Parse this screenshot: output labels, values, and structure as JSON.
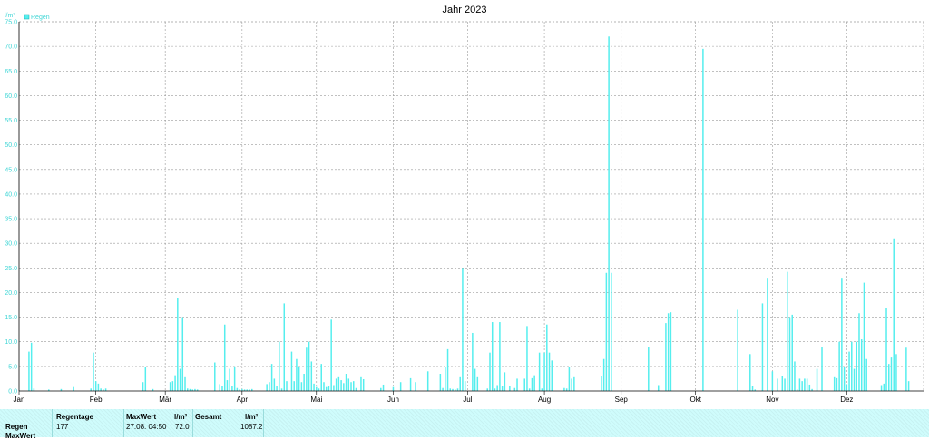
{
  "chart_data": {
    "type": "bar",
    "title": "Jahr 2023",
    "ylabel": "l/m²",
    "ylim": [
      0,
      75
    ],
    "yticks": [
      "0.0",
      "5.0",
      "10.0",
      "15.0",
      "20.0",
      "25.0",
      "30.0",
      "35.0",
      "40.0",
      "45.0",
      "50.0",
      "55.0",
      "60.0",
      "65.0",
      "70.0",
      "75.0"
    ],
    "months": [
      "Jan",
      "Feb",
      "Mär",
      "Apr",
      "Mai",
      "Jun",
      "Jul",
      "Aug",
      "Sep",
      "Okt",
      "Nov",
      "Dez"
    ],
    "grid": true,
    "legend_position": "top-left",
    "series": [
      {
        "name": "Regen",
        "color": "#55eeee",
        "days": [
          4,
          5,
          6,
          12,
          17,
          22,
          29,
          30,
          31,
          32,
          33,
          34,
          35,
          50,
          51,
          54,
          61,
          62,
          63,
          64,
          65,
          66,
          67,
          68,
          69,
          70,
          71,
          72,
          79,
          81,
          82,
          83,
          84,
          85,
          86,
          87,
          88,
          89,
          90,
          91,
          92,
          93,
          94,
          100,
          101,
          102,
          103,
          104,
          105,
          106,
          107,
          108,
          110,
          111,
          112,
          113,
          114,
          115,
          116,
          117,
          118,
          119,
          120,
          121,
          122,
          123,
          124,
          125,
          126,
          127,
          128,
          129,
          130,
          131,
          132,
          133,
          134,
          135,
          136,
          138,
          139,
          146,
          147,
          151,
          154,
          158,
          160,
          165,
          170,
          171,
          172,
          173,
          174,
          175,
          176,
          177,
          178,
          179,
          180,
          183,
          184,
          185,
          189,
          190,
          191,
          192,
          193,
          194,
          195,
          196,
          198,
          200,
          201,
          204,
          205,
          206,
          207,
          208,
          210,
          211,
          212,
          213,
          214,
          215,
          220,
          221,
          222,
          223,
          224,
          235,
          236,
          237,
          238,
          239,
          254,
          258,
          261,
          262,
          263,
          276,
          290,
          295,
          296,
          297,
          300,
          302,
          304,
          306,
          308,
          309,
          310,
          311,
          312,
          313,
          314,
          315,
          316,
          317,
          318,
          319,
          320,
          322,
          324,
          329,
          330,
          331,
          332,
          333,
          334,
          335,
          336,
          337,
          338,
          339,
          340,
          341,
          342,
          348,
          349,
          350,
          351,
          352,
          353,
          354,
          358,
          359
        ],
        "values": [
          8.0,
          9.8,
          0.5,
          0.3,
          0.4,
          0.8,
          0.5,
          7.8,
          2.0,
          1.5,
          0.5,
          0.3,
          0.5,
          1.8,
          4.8,
          0.4,
          1.8,
          2.0,
          3.2,
          18.8,
          4.5,
          15.0,
          2.8,
          0.5,
          0.4,
          0.3,
          0.4,
          0.3,
          5.8,
          1.4,
          1.0,
          13.5,
          2.2,
          4.5,
          1.0,
          5.0,
          0.6,
          0.3,
          0.4,
          0.3,
          0.3,
          0.3,
          0.4,
          1.4,
          1.8,
          5.5,
          2.5,
          1.0,
          10.0,
          0.5,
          17.8,
          2.0,
          8.0,
          2.0,
          6.5,
          4.8,
          1.8,
          3.5,
          8.8,
          10.0,
          6.0,
          1.5,
          0.8,
          0.5,
          5.5,
          1.8,
          0.8,
          1.0,
          14.5,
          1.2,
          2.5,
          2.8,
          2.2,
          1.6,
          3.5,
          2.5,
          1.8,
          2.0,
          0.6,
          2.8,
          2.4,
          0.6,
          1.3,
          0.8,
          1.8,
          2.6,
          1.8,
          4.0,
          3.5,
          0.6,
          4.8,
          8.5,
          0.5,
          0.4,
          0.3,
          0.5,
          2.8,
          25.0,
          2.0,
          11.8,
          4.5,
          2.8,
          0.5,
          7.8,
          14.0,
          0.5,
          1.2,
          14.0,
          1.0,
          3.8,
          1.0,
          0.6,
          2.5,
          2.5,
          13.2,
          0.5,
          2.6,
          3.2,
          7.8,
          0.5,
          7.8,
          13.5,
          7.8,
          6.2,
          0.6,
          0.5,
          4.8,
          2.5,
          2.8,
          3.0,
          6.5,
          24.0,
          72.0,
          24.0,
          9.0,
          1.2,
          13.8,
          15.8,
          16.0,
          69.5,
          16.5,
          7.5,
          1.0,
          0.3,
          17.8,
          23.0,
          4.0,
          2.5,
          3.0,
          2.5,
          24.2,
          15.0,
          15.5,
          6.0,
          0.3,
          2.5,
          2.0,
          2.5,
          2.5,
          1.3,
          0.4,
          4.5,
          9.0,
          2.8,
          2.6,
          10.0,
          23.0,
          4.8,
          1.4,
          8.0,
          10.0,
          4.5,
          10.0,
          15.8,
          10.5,
          22.0,
          6.5,
          1.2,
          1.5,
          16.8,
          5.5,
          6.8,
          31.0,
          7.5,
          8.8,
          2.0,
          5.5,
          13.2,
          3.0
        ]
      }
    ]
  },
  "legend": {
    "label": "Regen",
    "color": "#55eeee"
  },
  "stats": {
    "row_labels": [
      "Regen",
      "MaxWert"
    ],
    "col1_header": "Regentage",
    "col1_value": "177",
    "col2_header": "MaxWert",
    "col2_unit": "l/m²",
    "col2_date": "27.08.  04:50",
    "col2_value": "72.0",
    "col3_header": "Gesamt",
    "col3_unit": "l/m²",
    "col3_value": "1087.2"
  }
}
